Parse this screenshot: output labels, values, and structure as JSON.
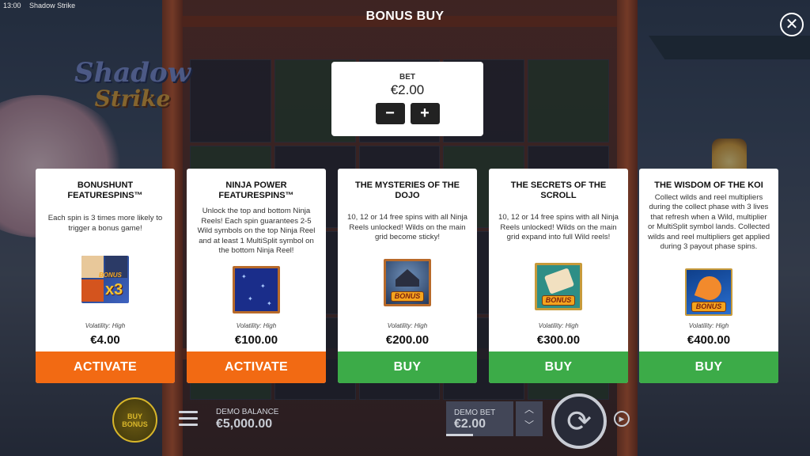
{
  "status_bar": {
    "time": "13:00",
    "app_title": "Shadow Strike"
  },
  "logo": {
    "line1": "Shadow",
    "line2": "Strike"
  },
  "header": {
    "title": "BONUS BUY",
    "close_icon": "close-icon"
  },
  "bet": {
    "label": "BET",
    "value": "€2.00",
    "minus": "−",
    "plus": "+"
  },
  "cards": [
    {
      "title": "BONUSHUNT FEATURESPINS™",
      "description": "Each spin is 3 times more likely to trigger a bonus game!",
      "icon": "bonushunt-icon",
      "volatility": "Volatility: High",
      "price": "€4.00",
      "button": "ACTIVATE",
      "button_color": "#f26a13"
    },
    {
      "title": "NINJA POWER FEATURESPINS™",
      "description": "Unlock the top and bottom Ninja Reels! Each spin guarantees 2-5 Wild symbols on the top Ninja Reel and at least 1 MultiSplit symbol on the bottom Ninja Reel!",
      "icon": "ninja-reel-icon",
      "volatility": "Volatility: High",
      "price": "€100.00",
      "button": "ACTIVATE",
      "button_color": "#f26a13"
    },
    {
      "title": "THE MYSTERIES OF THE DOJO",
      "description": "10, 12 or 14 free spins with all Ninja Reels unlocked! Wilds on the main grid become sticky!",
      "icon": "dojo-bonus-icon",
      "icon_tag": "BONUS",
      "volatility": "Volatility: High",
      "price": "€200.00",
      "button": "BUY",
      "button_color": "#3cab48"
    },
    {
      "title": "THE SECRETS OF THE SCROLL",
      "description": "10, 12 or 14 free spins with all Ninja Reels unlocked! Wilds on the main grid expand into full Wild reels!",
      "icon": "scroll-bonus-icon",
      "icon_tag": "BONUS",
      "volatility": "Volatility: High",
      "price": "€300.00",
      "button": "BUY",
      "button_color": "#3cab48"
    },
    {
      "title": "THE WISDOM OF THE KOI",
      "description": "Collect wilds and reel multipliers during the collect phase with 3 lives that refresh when a Wild, multiplier or MultiSplit symbol lands. Collected wilds and reel multipliers get applied during 3 payout phase spins.",
      "icon": "koi-bonus-icon",
      "icon_tag": "BONUS",
      "volatility": "Volatility: High",
      "price": "€400.00",
      "button": "BUY",
      "button_color": "#3cab48"
    }
  ],
  "bonushunt_icon_text": {
    "tag": "BONUS",
    "multiplier": "x3"
  },
  "bottom_bar": {
    "buy_bonus": "BUY BONUS",
    "balance_label": "DEMO BALANCE",
    "balance_value": "€5,000.00",
    "bet_label": "DEMO BET",
    "bet_value": "€2.00"
  }
}
